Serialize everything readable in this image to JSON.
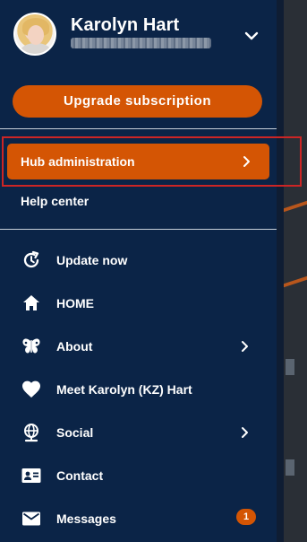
{
  "profile": {
    "name": "Karolyn Hart"
  },
  "actions": {
    "upgrade_label": "Upgrade subscription"
  },
  "admin": {
    "hub_label": "Hub administration",
    "help_label": "Help center"
  },
  "menu": {
    "items": [
      {
        "label": "Update now",
        "icon": "update-icon"
      },
      {
        "label": "HOME",
        "icon": "home-icon"
      },
      {
        "label": "About",
        "icon": "butterfly-icon"
      },
      {
        "label": "Meet Karolyn (KZ) Hart",
        "icon": "heart-icon"
      },
      {
        "label": "Social",
        "icon": "globe-icon"
      },
      {
        "label": "Contact",
        "icon": "contact-card-icon"
      },
      {
        "label": "Messages",
        "icon": "mail-icon",
        "badge": "1"
      }
    ]
  },
  "colors": {
    "drawer_bg": "#0b2447",
    "accent": "#d45504",
    "highlight_border": "#cc2525"
  }
}
